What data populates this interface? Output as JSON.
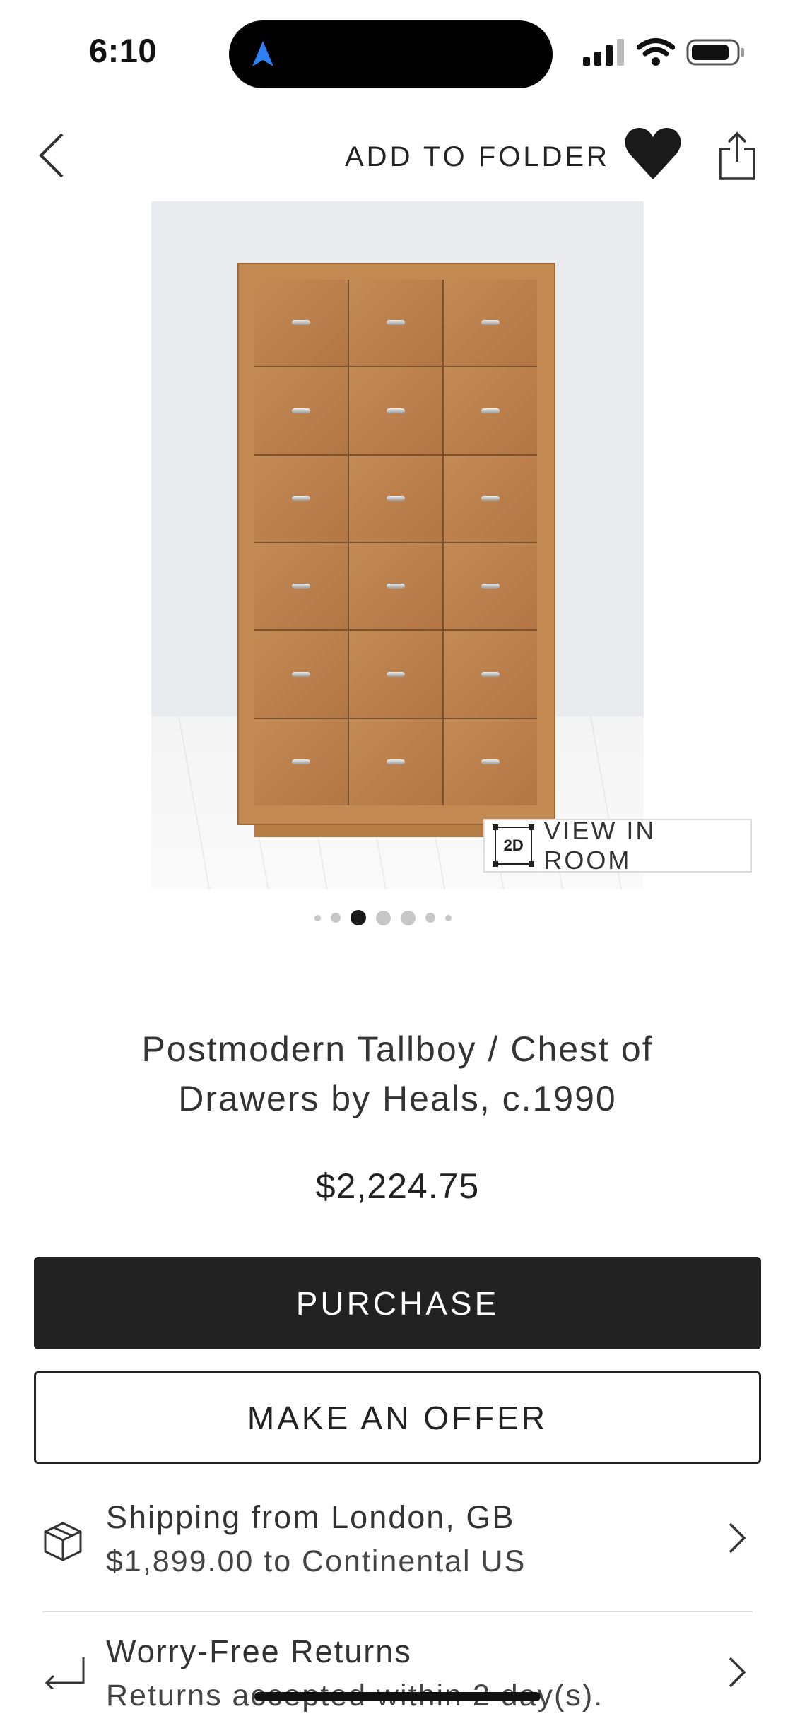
{
  "status_bar": {
    "time": "6:10",
    "icons": [
      "location-arrow-icon",
      "cellular-signal-icon",
      "wifi-icon",
      "battery-icon"
    ],
    "accent": "#2f80f5"
  },
  "nav": {
    "add_to_folder_label": "ADD TO FOLDER",
    "icons": [
      "back-chevron-icon",
      "heart-icon",
      "share-icon"
    ]
  },
  "gallery": {
    "view_in_room_badge": "2D",
    "view_in_room_label": "VIEW IN ROOM",
    "page_count": 7,
    "active_page": 3
  },
  "product": {
    "title": "Postmodern Tallboy / Chest of Drawers by Heals, c.1990",
    "price": "$2,224.75"
  },
  "actions": {
    "purchase_label": "PURCHASE",
    "offer_label": "MAKE AN OFFER"
  },
  "info_rows": [
    {
      "title": "Shipping from London, GB",
      "subtitle": "$1,899.00 to Continental US",
      "icon": "box-icon"
    },
    {
      "title": "Worry-Free Returns",
      "subtitle": "Returns accepted within 2 day(s).",
      "icon": "return-arrow-icon"
    }
  ]
}
